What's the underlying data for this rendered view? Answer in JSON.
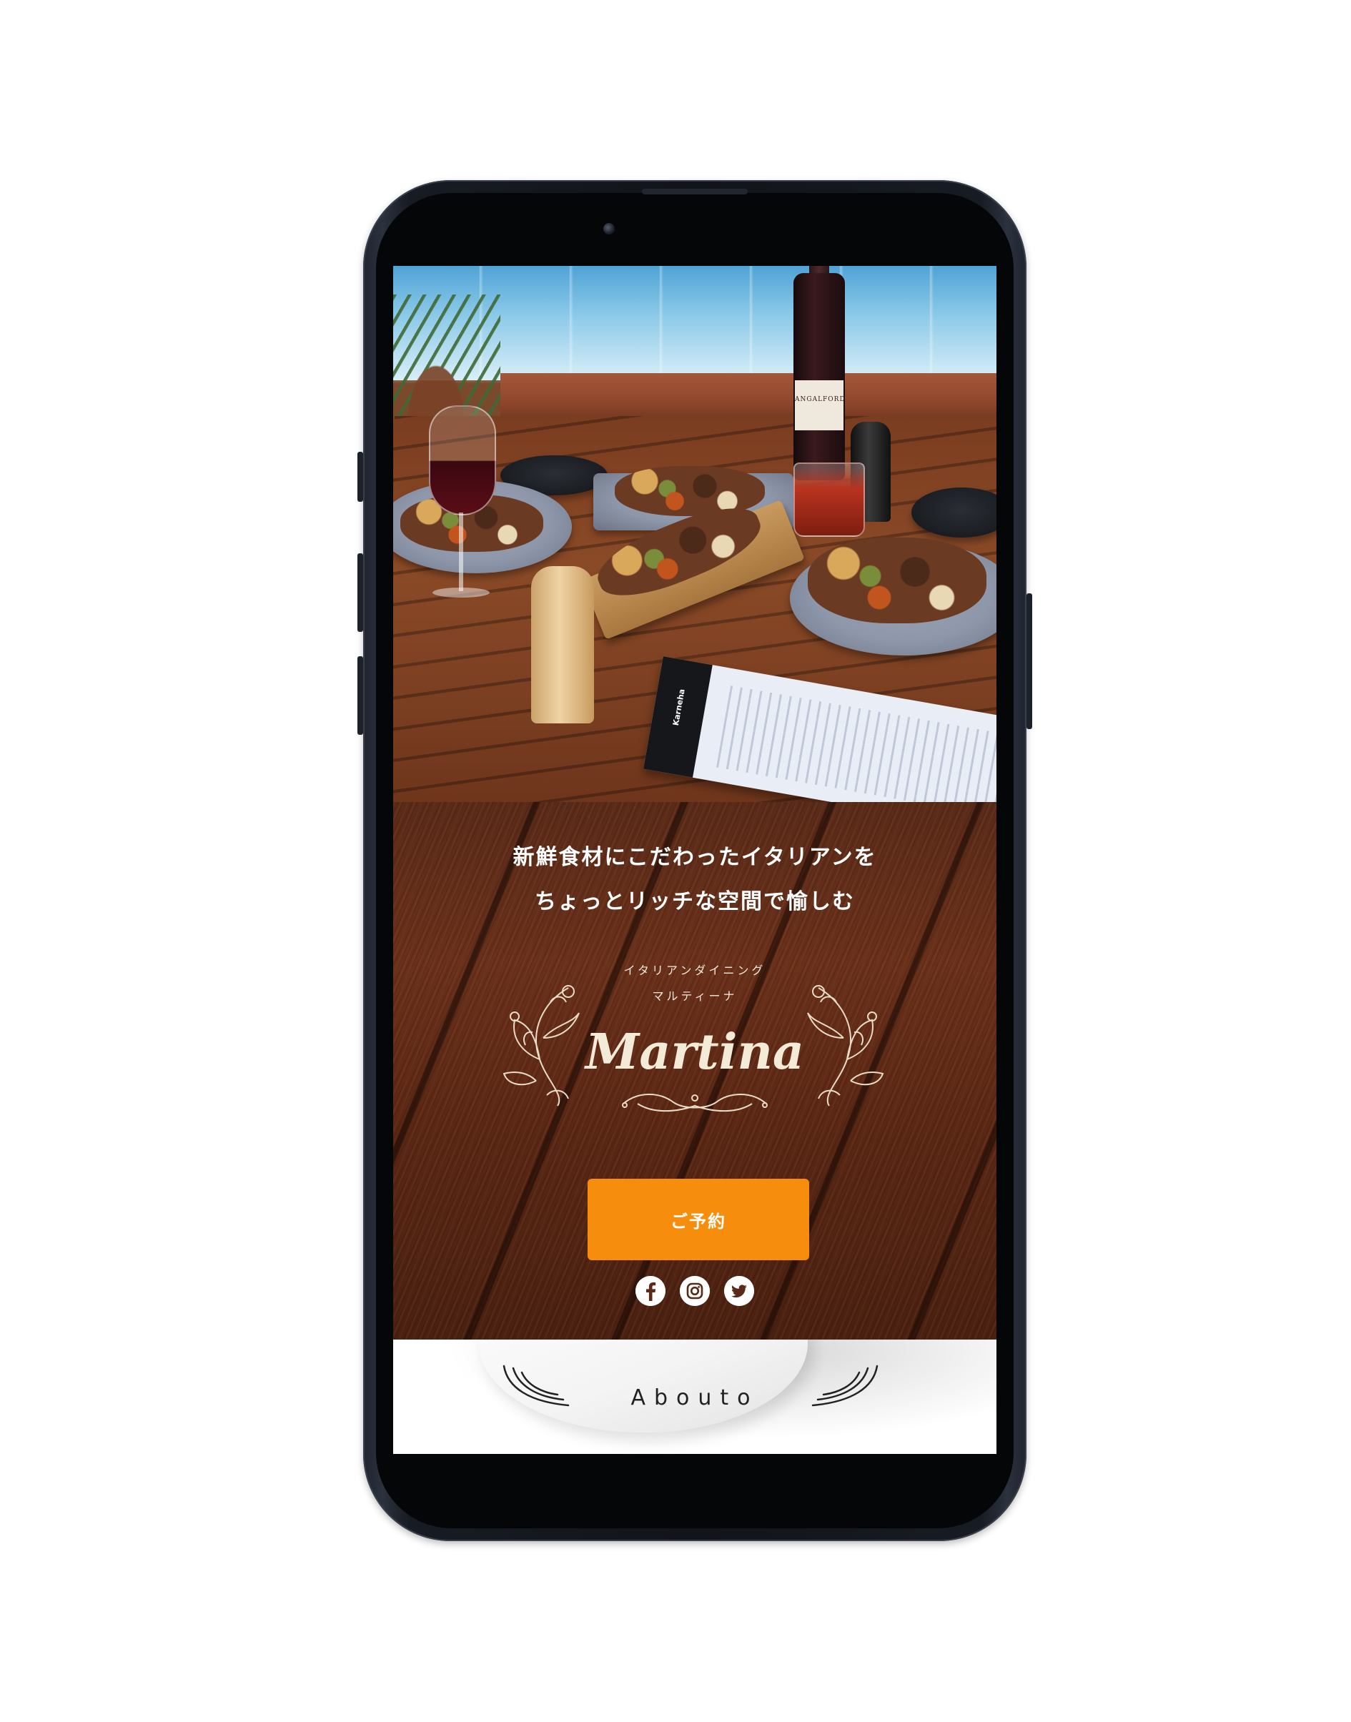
{
  "hero": {
    "image_alt": "Italian dishes and wine on an outdoor wooden table",
    "bottle_label": "ANGALFORD",
    "menu_brand": "Karneha"
  },
  "intro": {
    "tagline_line1": "新鮮食材にこだわったイタリアンを",
    "tagline_line2": "ちょっとリッチな空間で愉しむ",
    "subtitle_line1": "イタリアンダイニング",
    "subtitle_line2": "マルティーナ",
    "logo": "Martina"
  },
  "actions": {
    "reserve_label": "ご予約"
  },
  "social": {
    "items": [
      {
        "name": "facebook-icon"
      },
      {
        "name": "instagram-icon"
      },
      {
        "name": "twitter-icon"
      }
    ]
  },
  "about": {
    "title": "Abouto"
  },
  "colors": {
    "accent": "#f68d0c",
    "wood": "#5a2a18",
    "text_light": "#ffffff"
  }
}
